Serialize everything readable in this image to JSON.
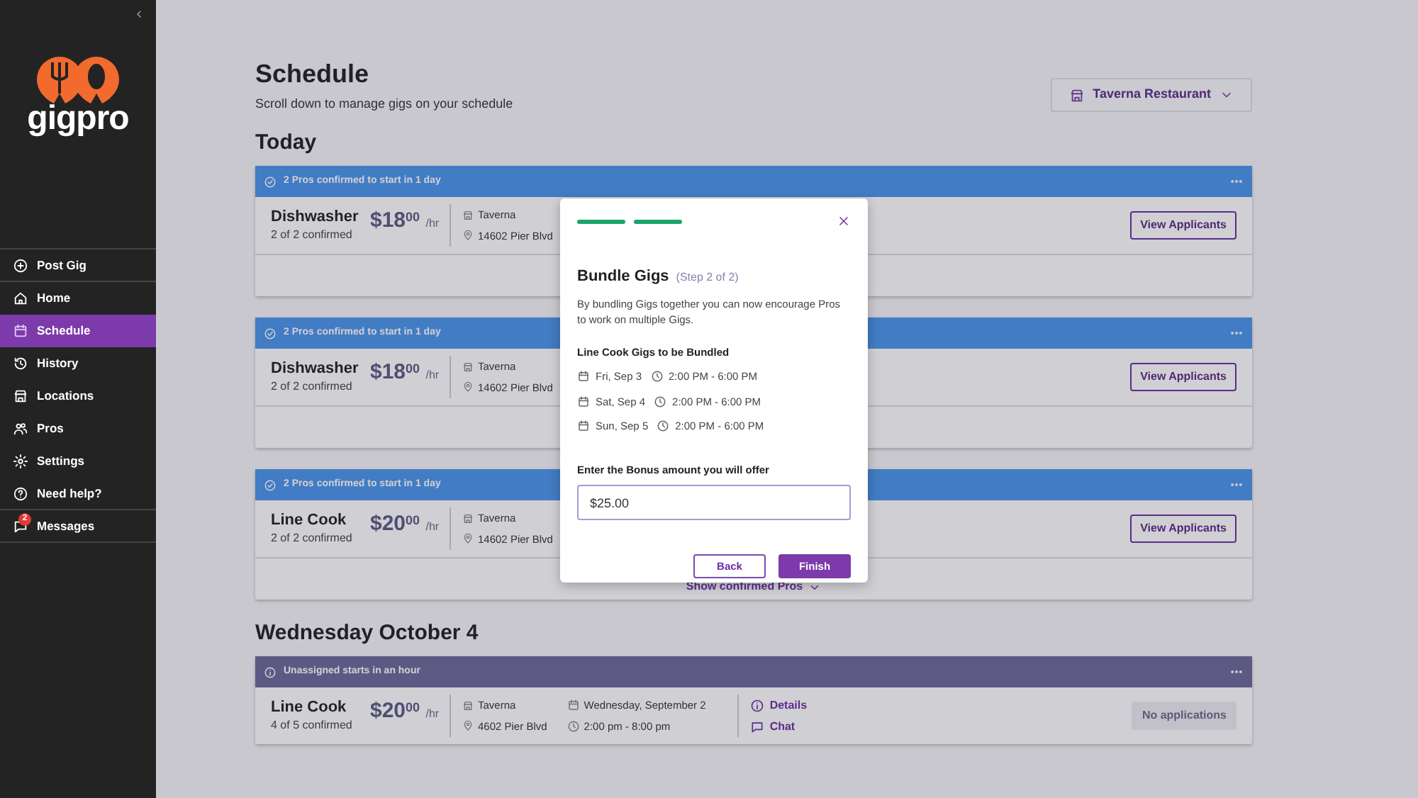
{
  "sidebar": {
    "logo": "gigpro",
    "items": [
      {
        "label": "Post Gig",
        "selected": false,
        "divider_after": true
      },
      {
        "label": "Home",
        "selected": false
      },
      {
        "label": "Schedule",
        "selected": true
      },
      {
        "label": "History",
        "selected": false
      },
      {
        "label": "Locations",
        "selected": false
      },
      {
        "label": "Pros",
        "selected": false
      },
      {
        "label": "Settings",
        "selected": false
      },
      {
        "label": "Need help?",
        "selected": false,
        "divider_after": true
      },
      {
        "label": "Messages",
        "selected": false,
        "badge": "2",
        "divider_after": true
      }
    ]
  },
  "header": {
    "title": "Schedule",
    "subtitle": "Scroll down to manage gigs on your schedule",
    "location": "Taverna Restaurant"
  },
  "sections": [
    {
      "title": "Today",
      "gigs": [
        {
          "kind": "confirmed",
          "status": "2 Pros confirmed to start in 1 day",
          "role": "Dishwasher",
          "confirmed": "2 of 2 confirmed",
          "price": "$18",
          "cents": "00",
          "unit": "/hr",
          "venue": "Taverna",
          "address": "14602 Pier Blvd",
          "action": {
            "label": "View Applicants",
            "kind": "outline"
          },
          "expandable": true
        },
        {
          "kind": "confirmed",
          "status": "2 Pros confirmed to start in 1 day",
          "role": "Dishwasher",
          "confirmed": "2 of 2 confirmed",
          "price": "$18",
          "cents": "00",
          "unit": "/hr",
          "venue": "Taverna",
          "address": "14602 Pier Blvd",
          "action": {
            "label": "View Applicants",
            "kind": "outline"
          },
          "expandable": true
        },
        {
          "kind": "confirmed",
          "status": "2 Pros confirmed to start in 1 day",
          "role": "Line Cook",
          "confirmed": "2 of 2 confirmed",
          "price": "$20",
          "cents": "00",
          "unit": "/hr",
          "venue": "Taverna",
          "address": "14602 Pier Blvd",
          "action": {
            "label": "View Applicants",
            "kind": "outline"
          },
          "expandable": true,
          "footer_label": "Show confirmed Pros"
        }
      ]
    },
    {
      "title": "Wednesday October 4",
      "gigs": [
        {
          "kind": "unassigned",
          "status": "Unassigned starts in an hour",
          "role": "Line Cook",
          "confirmed": "4 of 5 confirmed",
          "price": "$20",
          "cents": "00",
          "unit": "/hr",
          "venue": "Taverna",
          "address": "4602 Pier Blvd",
          "date": "Wednesday, September 2",
          "time": "2:00 pm - 8:00 pm",
          "links": [
            "Details",
            "Chat"
          ],
          "action": {
            "label": "No applications",
            "kind": "muted"
          },
          "expandable": false
        }
      ]
    }
  ],
  "modal": {
    "steps": [
      {
        "done": true
      },
      {
        "done": true
      }
    ],
    "title": "Bundle Gigs",
    "step": "(Step 2 of 2)",
    "description": "By bundling Gigs together you can now encourage Pros to work on multiple Gigs.",
    "list_title": "Line Cook Gigs to be Bundled",
    "gigs": [
      {
        "date": "Fri, Sep 3",
        "time": "2:00 PM - 6:00 PM"
      },
      {
        "date": "Sat, Sep 4",
        "time": "2:00 PM - 6:00 PM"
      },
      {
        "date": "Sun, Sep 5",
        "time": "2:00 PM - 6:00 PM"
      }
    ],
    "bonus_label": "Enter the Bonus amount you will offer",
    "bonus_value": "$25.00",
    "buttons": [
      {
        "label": "Back",
        "kind": "outline"
      },
      {
        "label": "Finish",
        "kind": "primary"
      }
    ]
  }
}
